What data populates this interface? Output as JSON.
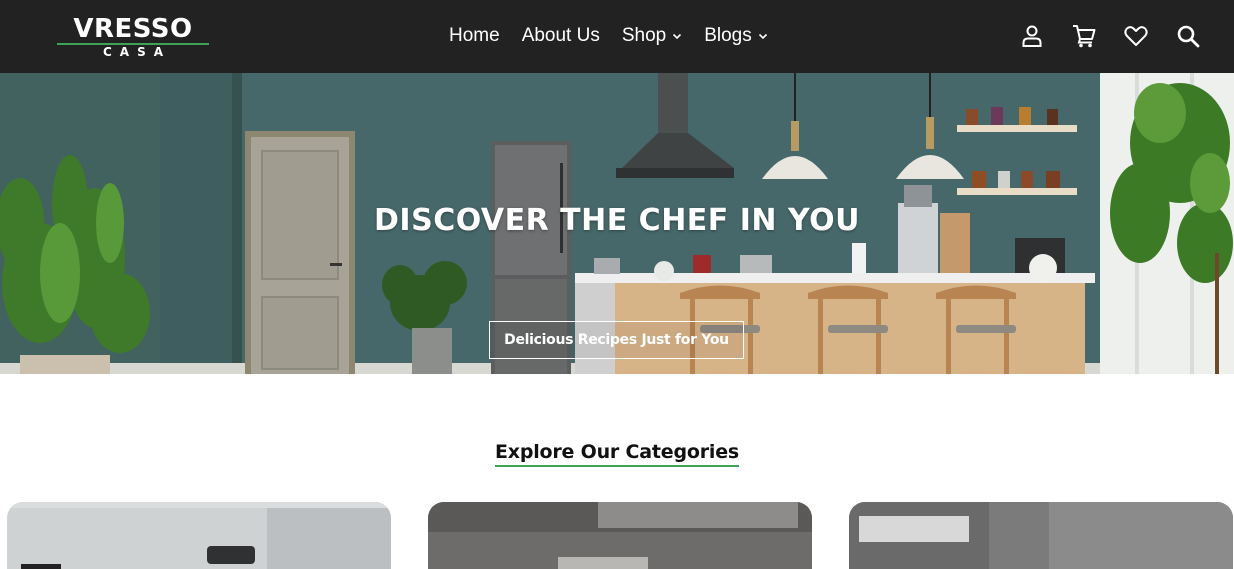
{
  "header": {
    "logo_brand": "VRESSO",
    "logo_sub": "CASA",
    "nav": [
      {
        "label": "Home",
        "has_dropdown": false
      },
      {
        "label": "About Us",
        "has_dropdown": false
      },
      {
        "label": "Shop",
        "has_dropdown": true
      },
      {
        "label": "Blogs",
        "has_dropdown": true
      }
    ],
    "icons": [
      "user-icon",
      "cart-icon",
      "heart-icon",
      "search-icon"
    ]
  },
  "hero": {
    "title": "DISCOVER THE CHEF IN YOU",
    "button_label": "Delicious Recipes Just for You"
  },
  "categories": {
    "title": "Explore Our Categories"
  },
  "colors": {
    "header_bg": "#222222",
    "accent_green": "#3fa357",
    "hero_wall": "#46676a"
  }
}
